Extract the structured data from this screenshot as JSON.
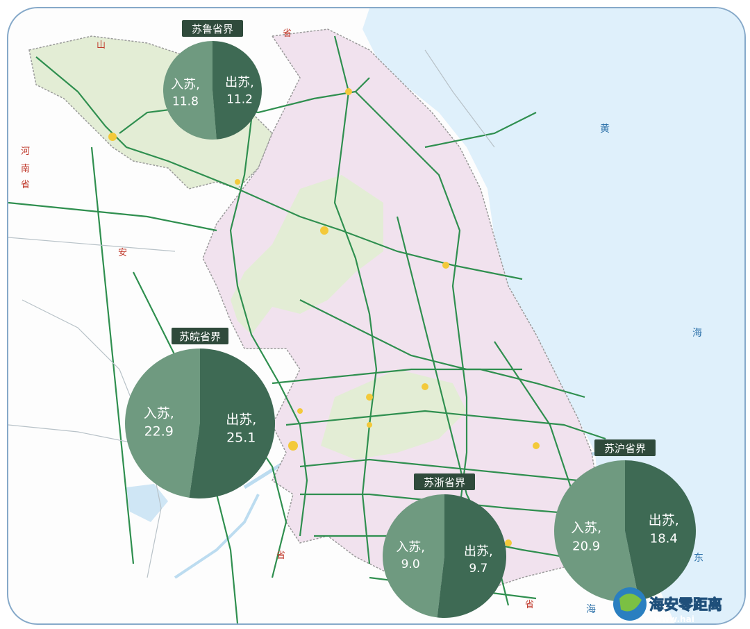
{
  "map_labels": {
    "shandong_prov_char": "山",
    "henan_province": [
      "河",
      "南",
      "省"
    ],
    "anhui_prov_char": "安",
    "sheng_top": "省",
    "sheng_bottom_left": "省",
    "sheng_bottom_right": "省",
    "yellow_sea": [
      "黄",
      "海"
    ],
    "east_char": "东",
    "hai_bottom": "海"
  },
  "pies": [
    {
      "region": "苏鲁省界",
      "in_label": "入苏,",
      "in_value": "11.8",
      "out_label": "出苏,",
      "out_value": "11.2",
      "in": 11.8,
      "out": 11.2
    },
    {
      "region": "苏皖省界",
      "in_label": "入苏,",
      "in_value": "22.9",
      "out_label": "出苏,",
      "out_value": "25.1",
      "in": 22.9,
      "out": 25.1
    },
    {
      "region": "苏浙省界",
      "in_label": "入苏,",
      "in_value": "9.0",
      "out_label": "出苏,",
      "out_value": "9.7",
      "in": 9.0,
      "out": 9.7
    },
    {
      "region": "苏沪省界",
      "in_label": "入苏,",
      "in_value": "20.9",
      "out_label": "出苏,",
      "out_value": "18.4",
      "in": 20.9,
      "out": 18.4
    }
  ],
  "colors": {
    "in_slice": "#6f9a80",
    "out_slice": "#3e6a54",
    "sea": "#dff0fb",
    "highway": "#2f8f4f",
    "province_fill_green": "#e3edd5",
    "province_fill_pink": "#f1e2ee"
  },
  "watermark": {
    "text": "海安零距离",
    "sub": "www.hai"
  }
}
